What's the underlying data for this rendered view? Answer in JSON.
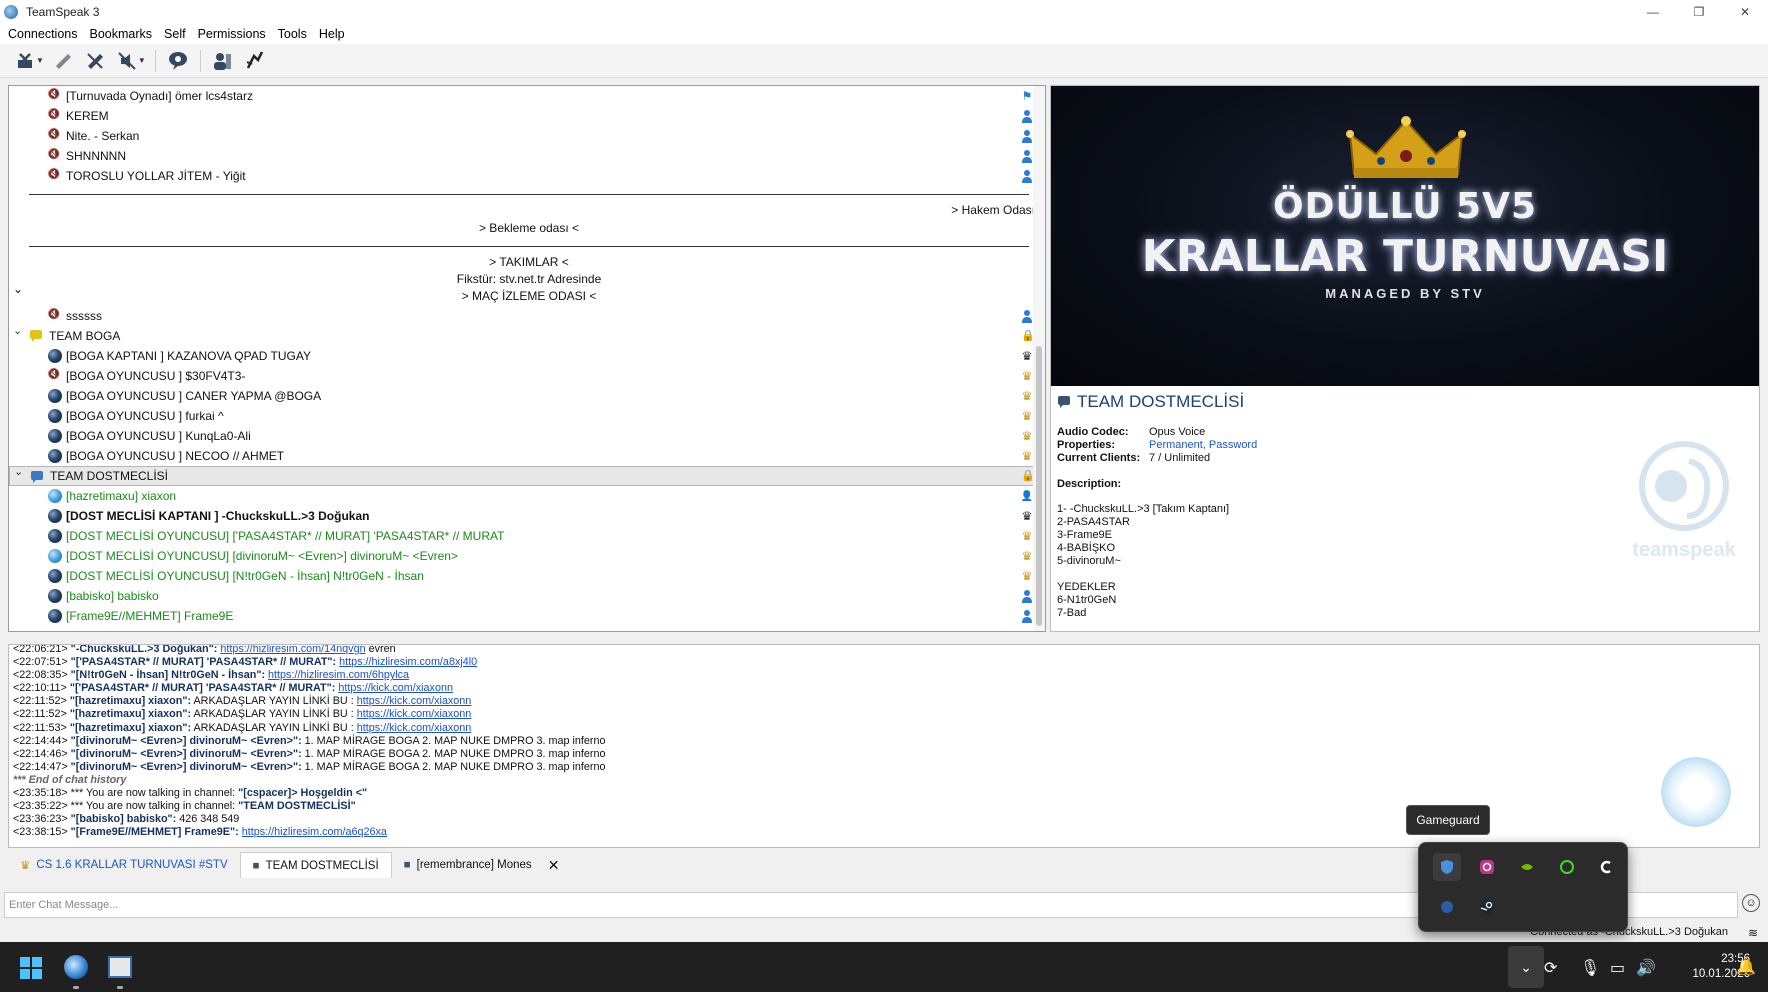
{
  "window": {
    "title": "TeamSpeak 3",
    "minimize": "—",
    "restore": "❐",
    "close": "✕"
  },
  "menu": [
    "Connections",
    "Bookmarks",
    "Self",
    "Permissions",
    "Tools",
    "Help"
  ],
  "tree": {
    "rows_top": [
      {
        "name": "[Turnuvada Oynadı] ömer   lcs4starz",
        "ricon": "flag-icon"
      },
      {
        "name": "KEREM",
        "ricon": "user-icon"
      },
      {
        "name": "Nite. - Serkan",
        "ricon": "user-icon"
      },
      {
        "name": "SHNNNNN",
        "ricon": "user-icon"
      },
      {
        "name": "TOROSLU YOLLAR JİTEM - Yiğit",
        "ricon": "user-icon"
      }
    ],
    "spacer_hakem": "> Hakem Odası",
    "spacer_bekleme": "> Bekleme odası <",
    "spacer_takimlar": "> TAKIMLAR <",
    "spacer_fikstur": "Fikstür: stv.net.tr  Adresinde",
    "spacer_mac": "> MAÇ İZLEME ODASI <",
    "mac_user": "ssssss",
    "team_boga": {
      "name": "TEAM BOGA",
      "users": [
        {
          "name": "[BOGA KAPTANI ] KAZANOVA QPAD TUGAY",
          "ricon": "crown-black"
        },
        {
          "name": "[BOGA OYUNCUSU ] $30FV4T3-",
          "ricon": "crown-gold"
        },
        {
          "name": "[BOGA OYUNCUSU ] CANER YAPMA @BOGA",
          "ricon": "crown-gold"
        },
        {
          "name": "[BOGA OYUNCUSU ] furkai ^",
          "ricon": "crown-gold"
        },
        {
          "name": "[BOGA OYUNCUSU ] KunqLa0-Ali",
          "ricon": "crown-gold"
        },
        {
          "name": "[BOGA OYUNCUSU ] NECOO // AHMET",
          "ricon": "crown-gold"
        }
      ]
    },
    "team_dost": {
      "name": "TEAM DOSTMECLİSİ",
      "users": [
        {
          "name": "[hazretimaxu] xiaxon",
          "ricon": "user-search",
          "color": "green"
        },
        {
          "name": "[DOST MECLİSİ KAPTANI ] -ChuckskuLL.>3 Doğukan",
          "ricon": "crown-black",
          "color": "bold"
        },
        {
          "name": "[DOST MECLİSİ OYUNCUSU] ['PASA4STAR*  // MURAT] 'PASA4STAR*  // MURAT",
          "ricon": "crown-gold",
          "color": "green"
        },
        {
          "name": "[DOST MECLİSİ OYUNCUSU] [divinoruM~ <Evren>] divinoruM~ <Evren>",
          "ricon": "crown-gold",
          "color": "green"
        },
        {
          "name": "[DOST MECLİSİ OYUNCUSU] [N!tr0GeN - İhsan] N!tr0GeN - İhsan",
          "ricon": "crown-gold",
          "color": "green"
        },
        {
          "name": "[babisko] babisko",
          "ricon": "user-icon",
          "color": "green"
        },
        {
          "name": "[Frame9E//MEHMET] Frame9E",
          "ricon": "user-icon",
          "color": "green"
        }
      ]
    }
  },
  "info": {
    "banner_line1": "ÖDÜLLÜ 5V5",
    "banner_line2": "KRALLAR TURNUVASI",
    "banner_line3": "MANAGED BY STV",
    "channel_title": "TEAM DOSTMECLİSİ",
    "audio_codec_label": "Audio Codec:",
    "audio_codec": "Opus Voice",
    "properties_label": "Properties:",
    "properties": "Permanent, Password",
    "clients_label": "Current Clients:",
    "clients": "7 / Unlimited",
    "description_label": "Description:",
    "description": "1- -ChuckskuLL.>3 [Takım Kaptanı]\n2-PASA4STAR\n3-Frame9E\n4-BABİŞKO\n5-divinoruM~\n\nYEDEKLER\n6-N1tr0GeN\n7-Bad"
  },
  "chat": [
    {
      "t": "<22:06:21>",
      "who": "\"-ChuckskuLL.>3 Doğukan\":",
      "link": "https://hizliresim.com/14nqvgn",
      "text": " evren"
    },
    {
      "t": "<22:07:51>",
      "who": "\"['PASA4STAR*  // MURAT] 'PASA4STAR*  // MURAT\":",
      "link": "https://hizliresim.com/a8xj4l0",
      "text": ""
    },
    {
      "t": "<22:08:35>",
      "who": "\"[N!tr0GeN - İhsan] N!tr0GeN - İhsan\":",
      "link": "https://hizliresim.com/6hpylca",
      "text": ""
    },
    {
      "t": "<22:10:11>",
      "who": "\"['PASA4STAR*  // MURAT] 'PASA4STAR*  // MURAT\":",
      "link": "https://kick.com/xiaxonn",
      "text": ""
    },
    {
      "t": "<22:11:52>",
      "who": "\"[hazretimaxu] xiaxon\":",
      "text0": " ARKADAŞLAR YAYIN LİNKİ BU : ",
      "link": "https://kick.com/xiaxonn",
      "text": ""
    },
    {
      "t": "<22:11:52>",
      "who": "\"[hazretimaxu] xiaxon\":",
      "text0": " ARKADAŞLAR YAYIN LİNKİ BU : ",
      "link": "https://kick.com/xiaxonn",
      "text": ""
    },
    {
      "t": "<22:11:53>",
      "who": "\"[hazretimaxu] xiaxon\":",
      "text0": " ARKADAŞLAR YAYIN LİNKİ BU : ",
      "link": "https://kick.com/xiaxonn",
      "text": ""
    },
    {
      "t": "<22:14:44>",
      "who": "\"[divinoruM~ <Evren>] divinoruM~ <Evren>\":",
      "text0": " 1. MAP MİRAGE BOGA 2. MAP NUKE DMPRO 3. map inferno",
      "link": "",
      "text": ""
    },
    {
      "t": "<22:14:46>",
      "who": "\"[divinoruM~ <Evren>] divinoruM~ <Evren>\":",
      "text0": " 1. MAP MİRAGE BOGA 2. MAP NUKE DMPRO 3. map inferno",
      "link": "",
      "text": ""
    },
    {
      "t": "<22:14:47>",
      "who": "\"[divinoruM~ <Evren>] divinoruM~ <Evren>\":",
      "text0": " 1. MAP MİRAGE BOGA 2. MAP NUKE DMPRO 3. map inferno",
      "link": "",
      "text": ""
    },
    {
      "hist": "*** End of chat history"
    },
    {
      "t": "<23:35:18>",
      "pre": " *** You are now talking in channel: ",
      "who": "\"[cspacer]> Hoşgeldin <\"",
      "link": "",
      "text": ""
    },
    {
      "t": "<23:35:22>",
      "pre": " *** You are now talking in channel: ",
      "who": "\"TEAM DOSTMECLİSİ\"",
      "link": "",
      "text": ""
    },
    {
      "t": "<23:36:23>",
      "who": "\"[babisko] babisko\":",
      "text0": " 426 348 549",
      "link": "",
      "text": ""
    },
    {
      "t": "<23:38:15>",
      "who": "\"[Frame9E//MEHMET] Frame9E\":",
      "link": "https://hizliresim.com/a6q26xa",
      "text": ""
    }
  ],
  "tabs": [
    {
      "label": "CS 1.6 KRALLAR TURNUVASI #STV"
    },
    {
      "label": "TEAM DOSTMECLİSİ"
    },
    {
      "label": "[remembrance] Mones"
    }
  ],
  "chat_input_placeholder": "Enter Chat Message...",
  "status_text": "Connected as -ChuckskuLL.>3 Doğukan",
  "tooltip": "Gameguard",
  "clock": {
    "time": "23:56",
    "date": "10.01.2026"
  }
}
